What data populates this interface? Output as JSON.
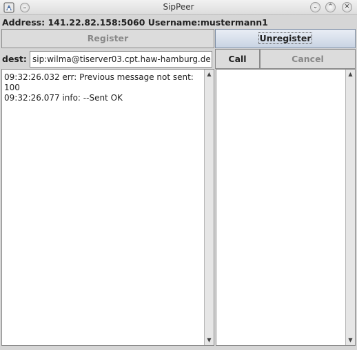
{
  "window": {
    "title": "SipPeer",
    "min_glyph": "⌄",
    "max_glyph": "⌃",
    "close_glyph": "✕"
  },
  "header": {
    "address_text": "Address: 141.22.82.158:5060 Username:mustermann1"
  },
  "buttons": {
    "register_label": "Register",
    "unregister_label": "Unregister",
    "call_label": "Call",
    "cancel_label": "Cancel"
  },
  "dest": {
    "label": "dest:",
    "value": "sip:wilma@tiserver03.cpt.haw-hamburg.de"
  },
  "log": {
    "lines": [
      "09:32:26.032 err: Previous message not sent: 100",
      "09:32:26.077 info: --Sent OK"
    ]
  },
  "icons": {
    "app": "app-icon",
    "menu": "window-menu-icon",
    "scroll_up": "▲",
    "scroll_down": "▼"
  }
}
